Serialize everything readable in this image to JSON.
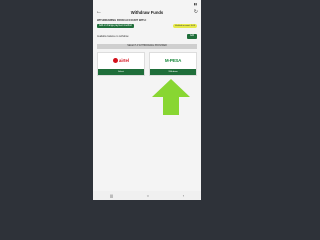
{
  "status_bar": {
    "time": "",
    "icons": "wifi-signal-battery"
  },
  "header": {
    "title": "Withdraw Funds",
    "back_icon": "arrow-left-icon",
    "refresh_icon": "refresh-icon"
  },
  "account": {
    "heading": "WITHDRAWING FROM ACCOUNT WITH:",
    "add_method_label": "Add or change payment method",
    "balance_pill": "Verified account: 0.00"
  },
  "amount": {
    "label": "Available balance to withdraw",
    "button": "Add"
  },
  "providers_banner": "SELECT A WITHDRAWAL PROVIDER",
  "providers": [
    {
      "name": "airtel",
      "logo_text": "airtel",
      "subtext": "",
      "select_label": "Select"
    },
    {
      "name": "mpesa",
      "logo_text": "M-PESA",
      "select_label": "Withdraw"
    }
  ],
  "colors": {
    "accent": "#1f6e3a",
    "highlight": "#e6e94a",
    "arrow": "#7ed321",
    "airtel": "#d3101b"
  },
  "nav": {
    "recent": "|||",
    "home": "○",
    "back": "‹"
  }
}
